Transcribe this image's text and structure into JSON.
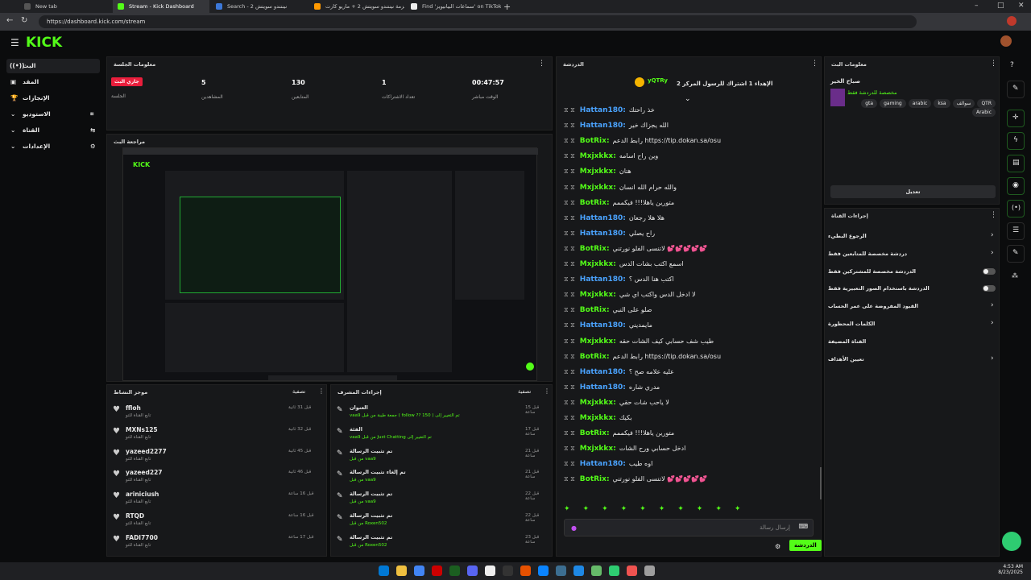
{
  "browser": {
    "tabs": [
      {
        "label": "New tab"
      },
      {
        "label": "Stream - Kick Dashboard"
      },
      {
        "label": "Search - 2 نينتندو سويتش"
      },
      {
        "label": "حزمة نينتندو سويتش 2 + ماريو كارت..."
      },
      {
        "label": "Find 'سماعات البيانيويز' on TikTok..."
      }
    ],
    "url": "https://dashboard.kick.com/stream"
  },
  "kick": {
    "logo": "KICK"
  },
  "nav": {
    "items": [
      "البث",
      "المقد",
      "الإنجازات",
      "الاستوديو",
      "القناة",
      "الإعدادات"
    ]
  },
  "session": {
    "title": "معلومات الجلسة",
    "status_badge": "جاري البث",
    "status_label": "الجلسة",
    "stats": [
      {
        "value": "5",
        "label": "المشاهدين"
      },
      {
        "value": "130",
        "label": "المتابعين"
      },
      {
        "value": "1",
        "label": "تعداد الاشتراكات"
      },
      {
        "value": "00:47:57",
        "label": "الوقت مباشر"
      }
    ]
  },
  "preview": {
    "title": "مراجعة البث"
  },
  "activity": {
    "title": "موجز النشاط",
    "filter": "تصفية",
    "items": [
      {
        "name": "ffloh",
        "sub": "تابع القناة للتو",
        "time": "قبل 31 ثانية"
      },
      {
        "name": "MXNs125",
        "sub": "تابع القناة للتو",
        "time": "قبل 32 ثانية"
      },
      {
        "name": "yazeed2277",
        "sub": "تابع القناة للتو",
        "time": "قبل 45 ثانية"
      },
      {
        "name": "yazeed227",
        "sub": "تابع القناة للتو",
        "time": "قبل 46 ثانية"
      },
      {
        "name": "ariniciush",
        "sub": "تابع القناة للتو",
        "time": "قبل 16 ساعة"
      },
      {
        "name": "RTQD",
        "sub": "تابع القناة للتو",
        "time": "قبل 16 ساعة"
      },
      {
        "name": "FADI7700",
        "sub": "تابع القناة للتو",
        "time": "قبل 17 ساعة"
      }
    ]
  },
  "modactions": {
    "title": "إجراءات المشرف",
    "filter": "تصفية",
    "items": [
      {
        "title": "العنوان",
        "desc": "vaa9 جمعة طيبة من قبل ( follow ?? 150 ) تم التغيير إلى",
        "time": "قبل 15 ساعة"
      },
      {
        "title": "الفئة",
        "desc": "vaa9 من قبل Just Chatting تم التغيير إلى",
        "time": "قبل 17 ساعة"
      },
      {
        "title": "تم تثبيت الرسالة",
        "desc": "من قبل vaa9",
        "time": "قبل 21 ساعة"
      },
      {
        "title": "تم إلغاء تثبيت الرسالة",
        "desc": "من قبل vaa9",
        "time": "قبل 21 ساعة"
      },
      {
        "title": "تم تثبيت الرسالة",
        "desc": "من قبل vaa9",
        "time": "قبل 22 ساعة"
      },
      {
        "title": "تم تثبيت الرسالة",
        "desc": "من قبل Roxen502",
        "time": "قبل 22 ساعة"
      },
      {
        "title": "تم تثبيت الرسالة",
        "desc": "من قبل Roxen502",
        "time": "قبل 23 ساعة"
      }
    ]
  },
  "chat": {
    "title": "الدردشة",
    "pinned_user": "yQTRy",
    "pinned_text": "الإهداء 1 اشتراك للرسول المركز 2",
    "messages": [
      {
        "user": "Hattan180",
        "text": "خذ راحتك",
        "color": "#4aa3ff"
      },
      {
        "user": "Hattan180",
        "text": "الله يجزاك خير",
        "color": "#4aa3ff"
      },
      {
        "user": "BotRix",
        "text": "رابط الدعم https://tip.dokan.sa/osu",
        "color": "#53fc18"
      },
      {
        "user": "Mxjxkkx",
        "text": "وين راح اسامه",
        "color": "#53fc18"
      },
      {
        "user": "Mxjxkkx",
        "text": "هتان",
        "color": "#53fc18"
      },
      {
        "user": "Mxjxkkx",
        "text": "والله حرام الله انسان",
        "color": "#53fc18"
      },
      {
        "user": "BotRix",
        "text": "متورين ياهلا!!! فيكممم",
        "color": "#53fc18"
      },
      {
        "user": "Hattan180",
        "text": "هلا هلا رجعان",
        "color": "#4aa3ff"
      },
      {
        "user": "Hattan180",
        "text": "راح يصلي",
        "color": "#4aa3ff"
      },
      {
        "user": "BotRix",
        "text": "لاتنسى الفلو نورتني 💕💕💕💕💕",
        "color": "#53fc18"
      },
      {
        "user": "Mxjxkkx",
        "text": "اسمع اكتب بشات الدس",
        "color": "#53fc18"
      },
      {
        "user": "Hattan180",
        "text": "اكتب هنا الدس ؟",
        "color": "#4aa3ff"
      },
      {
        "user": "Mxjxkkx",
        "text": "لا ادخل الدس واكتب اي شي",
        "color": "#53fc18"
      },
      {
        "user": "BotRix",
        "text": "صلو على النبي",
        "color": "#53fc18"
      },
      {
        "user": "Hattan180",
        "text": "مايمديني",
        "color": "#4aa3ff"
      },
      {
        "user": "Mxjxkkx",
        "text": "طيب شف حسابي كيف الشات حقه",
        "color": "#53fc18"
      },
      {
        "user": "BotRix",
        "text": "رابط الدعم https://tip.dokan.sa/osu",
        "color": "#53fc18"
      },
      {
        "user": "Hattan180",
        "text": "عليه علامه صح ؟",
        "color": "#4aa3ff"
      },
      {
        "user": "Hattan180",
        "text": "مدري شاره",
        "color": "#4aa3ff"
      },
      {
        "user": "Mxjxkkx",
        "text": "لا ياحب شات حقي",
        "color": "#53fc18"
      },
      {
        "user": "Mxjxkkx",
        "text": "بكيك",
        "color": "#53fc18"
      },
      {
        "user": "BotRix",
        "text": "متورين ياهلا!!! فيكممم",
        "color": "#53fc18"
      },
      {
        "user": "Mxjxkkx",
        "text": "ادخل حسابي ورح الشات",
        "color": "#53fc18"
      },
      {
        "user": "Hattan180",
        "text": "اوه طيب",
        "color": "#4aa3ff"
      },
      {
        "user": "BotRix",
        "text": "لاتنسى الفلو نورتني 💕💕💕💕💕",
        "color": "#53fc18"
      }
    ],
    "input_placeholder": "إرسال رسالة",
    "send_label": "الدردشة"
  },
  "streaminfo": {
    "title": "معلومات البث",
    "stream_title": "صباح الخير",
    "category": "مخصصة للدردشة فقط",
    "tags": [
      "QTR",
      "سوالف",
      "ksa",
      "arabic",
      "gaming",
      "gta",
      "Arabic"
    ],
    "edit_label": "تعديل"
  },
  "channel_actions": {
    "title": "إجراءات القناة",
    "items": [
      {
        "label": "الرجوع البطيء",
        "control": "chevron"
      },
      {
        "label": "دردشة مخصصة للمتابعين فقط",
        "control": "chevron"
      },
      {
        "label": "الدردشة مخصصة للمشتركين فقط",
        "control": "toggle"
      },
      {
        "label": "الدردشة باستخدام الصور التعبيرية فقط",
        "control": "toggle"
      },
      {
        "label": "القيود المفروضة على عمر الحساب",
        "control": "chevron"
      },
      {
        "label": "الكلمات المحظورة",
        "control": "chevron"
      },
      {
        "label": "القناة المضيفة",
        "control": "none"
      },
      {
        "label": "تعيين الأهداف",
        "control": "chevron"
      }
    ]
  },
  "taskbar": {
    "time": "4:53 AM",
    "date": "8/23/2025"
  },
  "colors": {
    "accent": "#53fc18",
    "badge": "#e91e3c"
  }
}
